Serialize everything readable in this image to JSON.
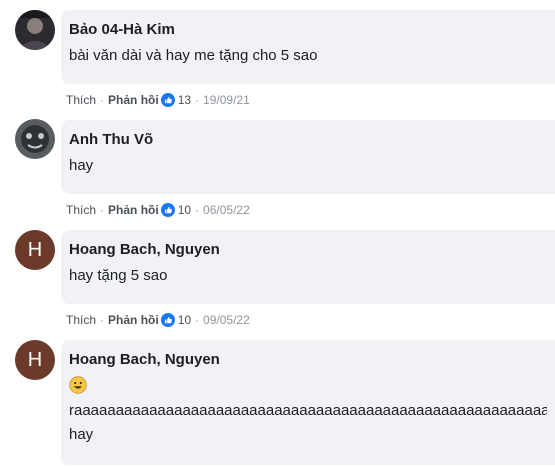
{
  "comments": [
    {
      "author": "Bảo 04-Hà Kim",
      "avatar_type": "photo-dark",
      "lines": [
        "bài văn dài và hay me tặng cho 5 sao"
      ],
      "like_label": "Thích",
      "reply_label": "Phản hồi",
      "reaction_count": "13",
      "date": "19/09/21"
    },
    {
      "author": "Anh Thu Võ",
      "avatar_type": "photo-gray",
      "lines": [
        "hay"
      ],
      "like_label": "Thích",
      "reply_label": "Phản hồi",
      "reaction_count": "10",
      "date": "06/05/22"
    },
    {
      "author": "Hoang Bach, Nguyen",
      "avatar_type": "letter",
      "avatar_letter": "H",
      "lines": [
        "hay tặng 5 sao"
      ],
      "like_label": "Thích",
      "reply_label": "Phản hồi",
      "reaction_count": "10",
      "date": "09/05/22"
    },
    {
      "author": "Hoang Bach, Nguyen",
      "avatar_type": "letter",
      "avatar_letter": "H",
      "emoji": "smiley-emoji",
      "lines": [
        "raaaaaaaaaaaaaaaaaaaaaaaaaaaaaaaaaaaaaaaaaaaaaaaaaaaaaaaaaaaaaaaaaaaaaaa",
        "hay"
      ]
    }
  ],
  "colors": {
    "bubble": "#f0f2f5",
    "meta_text": "#90949c",
    "like_blue": "#1877f2",
    "letter_avatar": "#6b3a2a",
    "emoji_yellow": "#f7c844"
  }
}
